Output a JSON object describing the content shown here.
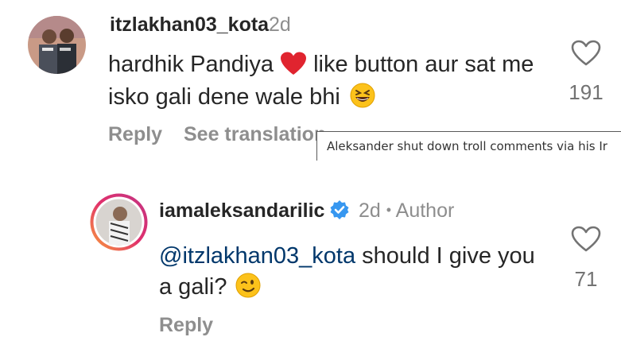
{
  "comment": {
    "username": "itzlakhan03_kota",
    "time": "2d",
    "line1_before": "hardhik Pandiya",
    "line1_after": " like button  aur sat me",
    "line2": "isko gali dene wale bhi",
    "reply_label": "Reply",
    "translation_label": "See translation",
    "like_count": "191",
    "icons": {
      "heart": "red-heart-emoji",
      "emoji": "grinning-squinting-face-emoji",
      "like": "heart-outline-icon"
    },
    "colors": {
      "heart": "#e0242f"
    }
  },
  "reply": {
    "username": "iamaleksandarilic",
    "time": "2d",
    "separator": "•",
    "role": "Author",
    "mention": "@itzlakhan03_kota",
    "line1_after": " should I give you",
    "line2": "a gali?",
    "reply_label": "Reply",
    "like_count": "71",
    "icons": {
      "verified": "verified-badge-icon",
      "emoji": "winking-face-emoji",
      "like": "heart-outline-icon"
    },
    "colors": {
      "verified": "#3797f0",
      "mention": "#00376b"
    }
  },
  "caption": {
    "text": "Aleksander shut down troll comments via his Ir"
  }
}
